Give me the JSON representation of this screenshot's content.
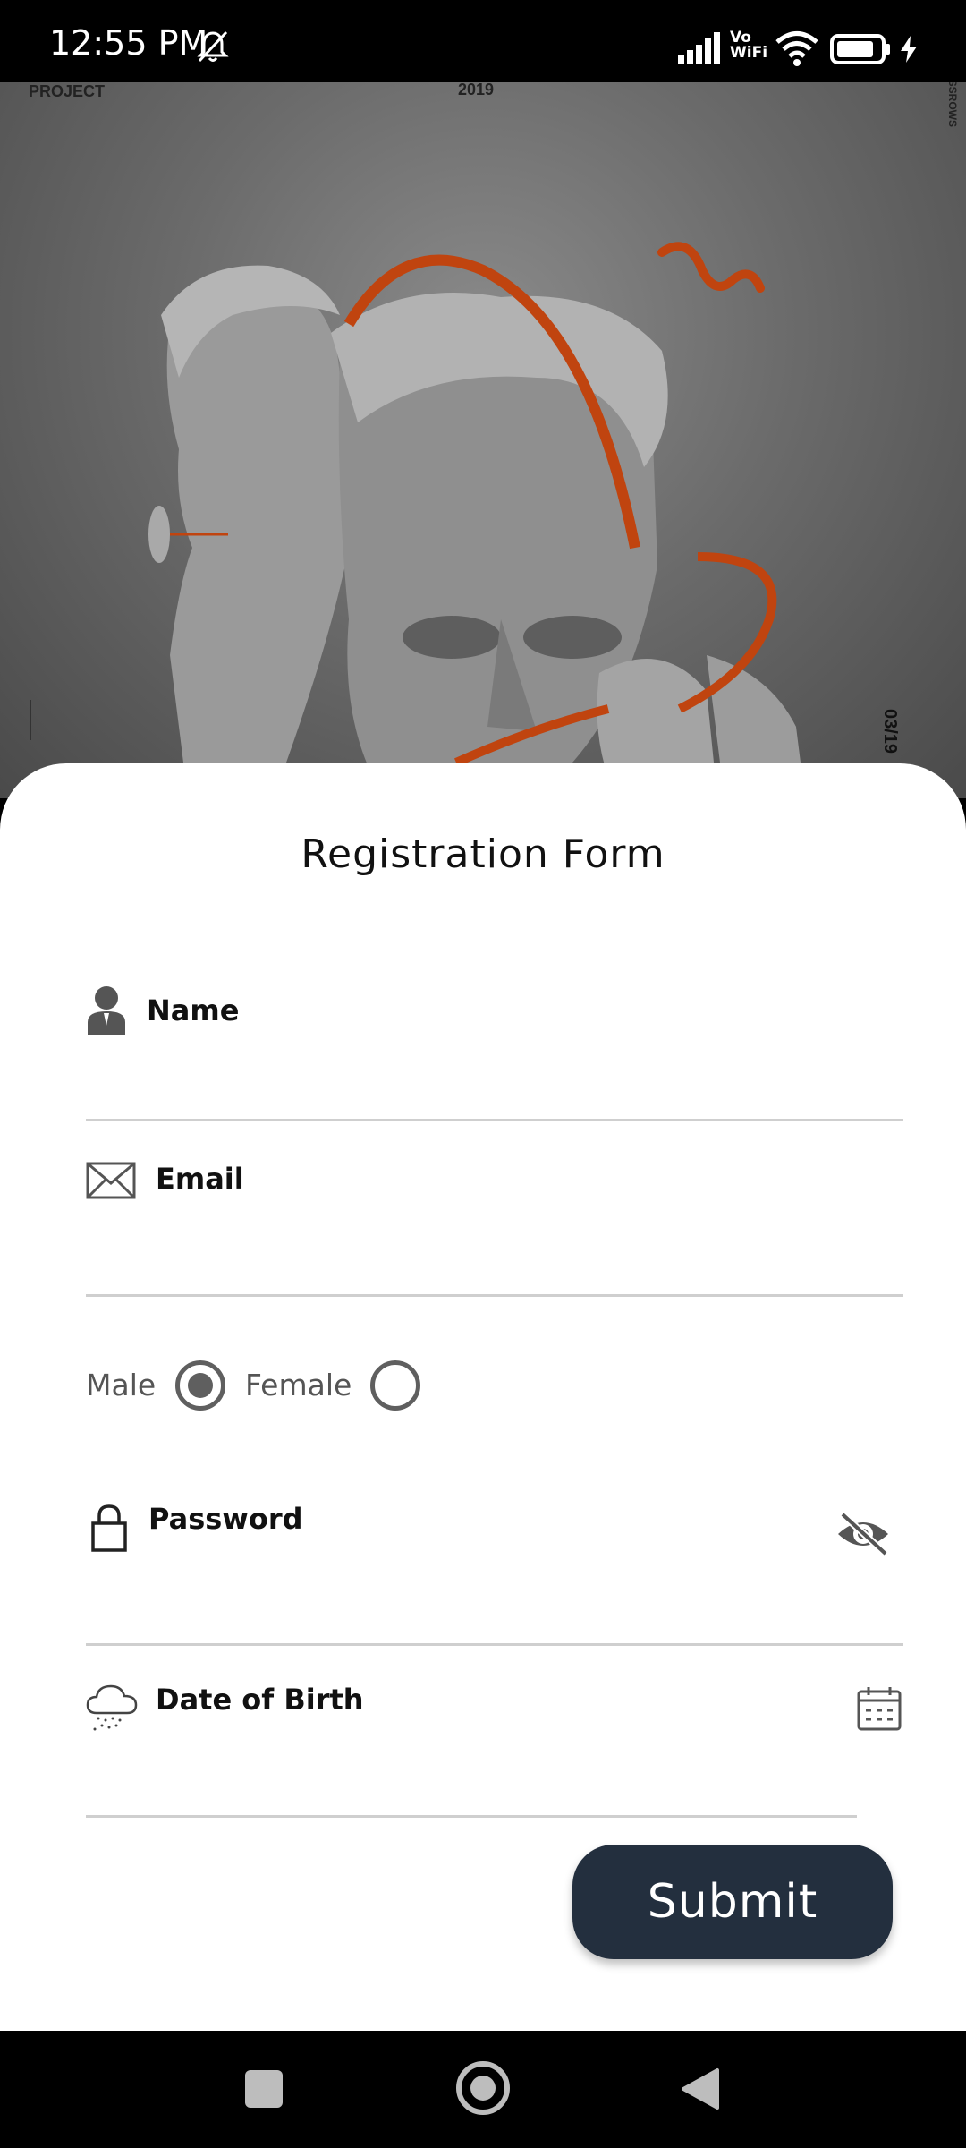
{
  "status_bar": {
    "time": "12:55 PM",
    "network_label": "Vo WiFi",
    "icons": [
      "bell-muted-icon",
      "signal-icon",
      "wifi-icon",
      "battery-icon",
      "charging-icon"
    ]
  },
  "hero": {
    "top_left_text": "PROJECT",
    "top_center_text": "2019",
    "side_text": "CROSSROWS",
    "slide_counter": "03/19",
    "accent_color": "#c0440f"
  },
  "form": {
    "title": "Registration Form",
    "fields": {
      "name": {
        "label": "Name",
        "icon": "person-icon",
        "value": ""
      },
      "email": {
        "label": "Email",
        "icon": "envelope-icon",
        "value": ""
      },
      "password": {
        "label": "Password",
        "icon": "lock-icon",
        "toggle_icon": "eye-off-icon",
        "value": ""
      },
      "dob": {
        "label": "Date of Birth",
        "icon": "cloud-snow-icon",
        "picker_icon": "calendar-icon",
        "value": ""
      }
    },
    "gender": {
      "options": [
        {
          "label": "Male",
          "selected": true
        },
        {
          "label": "Female",
          "selected": false
        }
      ]
    },
    "submit_label": "Submit",
    "submit_color": "#232f3e"
  },
  "nav_bar": {
    "buttons": [
      "recent-apps-button",
      "home-button",
      "back-button"
    ]
  }
}
